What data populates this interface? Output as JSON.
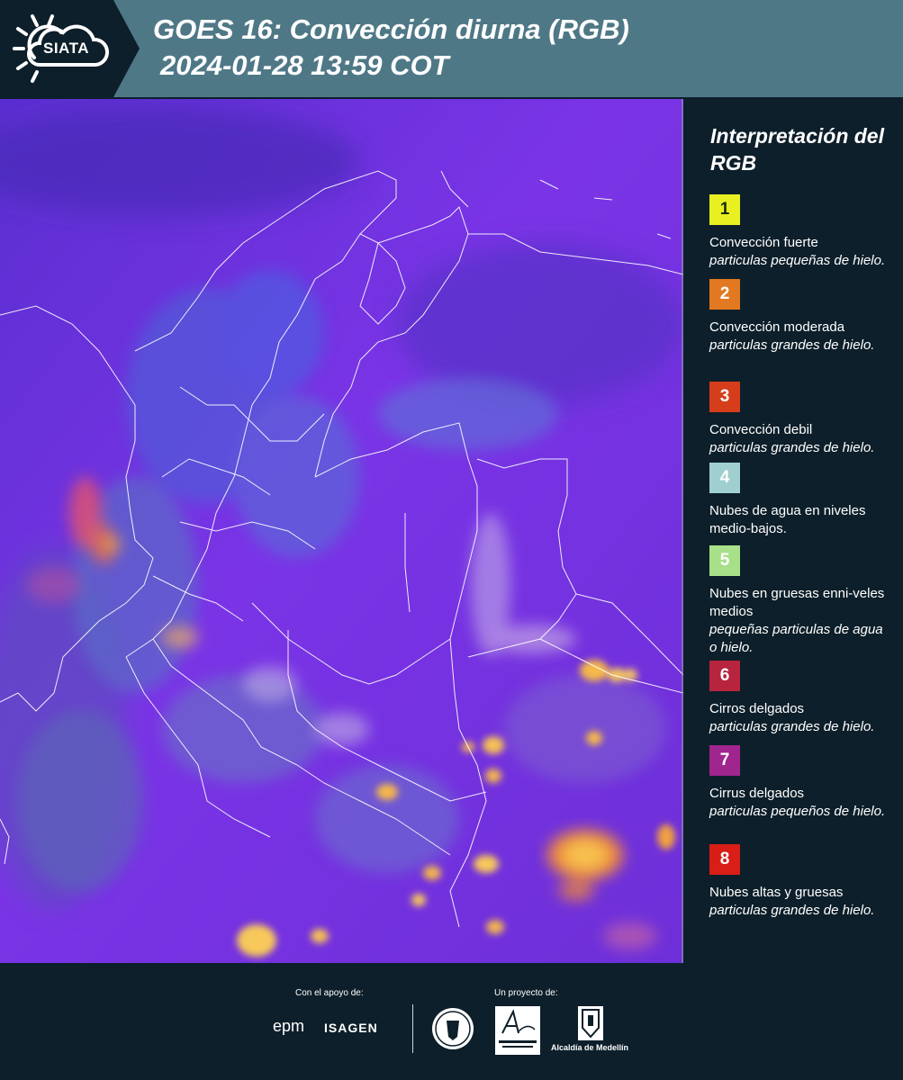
{
  "header": {
    "logo_text": "SIATA",
    "title_line1": "GOES 16: Convección diurna (RGB)",
    "title_line2": "2024-01-28 13:59 COT"
  },
  "legend": {
    "title": "Interpretación del RGB",
    "items": [
      {
        "number": "1",
        "label": "Convección fuerte",
        "sub": "particulas pequeñas de hielo.",
        "color": "#e9f021",
        "text_color": "#1b2a10"
      },
      {
        "number": "2",
        "label": "Convección moderada",
        "sub": "particulas grandes de hielo.",
        "color": "#e2781f",
        "text_color": "#ffffff"
      },
      {
        "number": "3",
        "label": "Convección debil",
        "sub": "particulas grandes de hielo.",
        "color": "#d53d1b",
        "text_color": "#ffffff"
      },
      {
        "number": "4",
        "label": "Nubes de agua en niveles medio-bajos.",
        "sub": "",
        "color": "#9fcfcf",
        "text_color": "#ffffff"
      },
      {
        "number": "5",
        "label": "Nubes en gruesas enni-veles medios",
        "sub": "pequeñas particulas de agua o hielo.",
        "color": "#a8e08a",
        "text_color": "#ffffff"
      },
      {
        "number": "6",
        "label": "Cirros delgados",
        "sub": "particulas grandes de hielo.",
        "color": "#b8243e",
        "text_color": "#ffffff"
      },
      {
        "number": "7",
        "label": "Cirrus delgados",
        "sub": "particulas pequeños de hielo.",
        "color": "#a0258f",
        "text_color": "#ffffff"
      },
      {
        "number": "8",
        "label": "Nubes altas y gruesas",
        "sub": "particulas grandes de hielo.",
        "color": "#d81e16",
        "text_color": "#ffffff"
      }
    ]
  },
  "footer": {
    "support_label": "Con el apoyo de:",
    "project_label": "Un proyecto de:",
    "epm": "epm",
    "isagen": "ISAGEN",
    "alcaldia": "Alcaldía de Medellín",
    "area_logo_text": "Área METROPOLITANA Valle de Aburrá"
  }
}
